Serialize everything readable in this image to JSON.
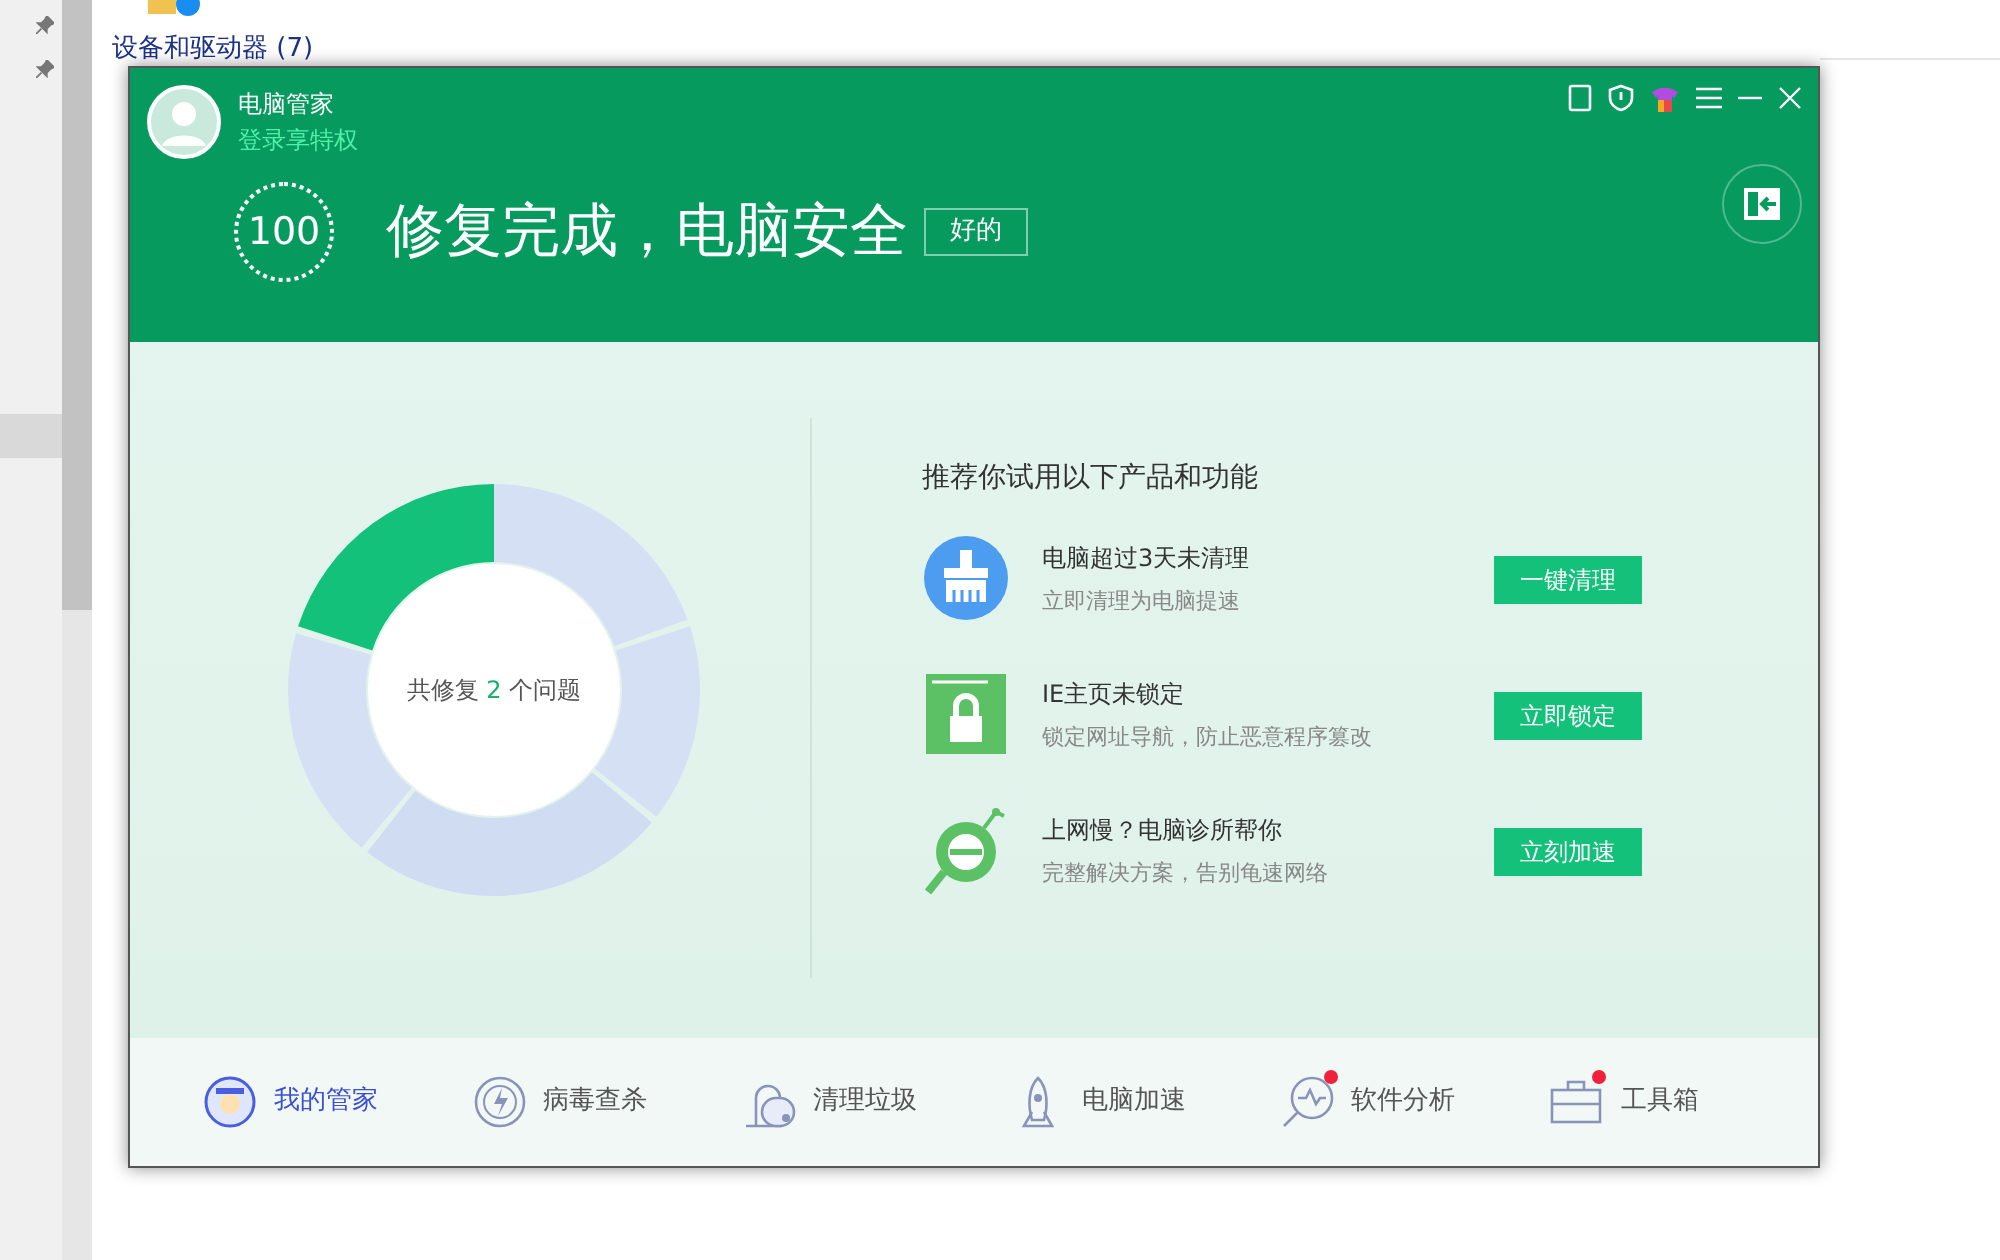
{
  "explorer": {
    "group_heading": "设备和驱动器 (7)"
  },
  "window": {
    "app_name": "电脑管家",
    "login_link": "登录享特权",
    "score": "100",
    "status_title": "修复完成，电脑安全",
    "status_badge": "好的",
    "summary": "共修复 **2** 个问题",
    "recommend_title": "推荐你试用以下产品和功能",
    "recommendations": [
      {
        "kind": "clean",
        "title": "电脑超过3天未清理",
        "subtitle": "立即清理为电脑提速",
        "button": "一键清理"
      },
      {
        "kind": "lock",
        "title": "IE主页未锁定",
        "subtitle": "锁定网址导航，防止恶意程序篡改",
        "button": "立即锁定"
      },
      {
        "kind": "speed",
        "title": "上网慢？电脑诊所帮你",
        "subtitle": "完整解决方案，告别龟速网络",
        "button": "立刻加速"
      }
    ],
    "nav": [
      {
        "kind": "home",
        "label": "我的管家",
        "selected": true,
        "notification": false
      },
      {
        "kind": "virus",
        "label": "病毒查杀",
        "selected": false,
        "notification": false
      },
      {
        "kind": "trash",
        "label": "清理垃圾",
        "selected": false,
        "notification": false
      },
      {
        "kind": "rocket",
        "label": "电脑加速",
        "selected": false,
        "notification": false
      },
      {
        "kind": "analysis",
        "label": "软件分析",
        "selected": false,
        "notification": true
      },
      {
        "kind": "toolbox",
        "label": "工具箱",
        "selected": false,
        "notification": true
      }
    ]
  }
}
